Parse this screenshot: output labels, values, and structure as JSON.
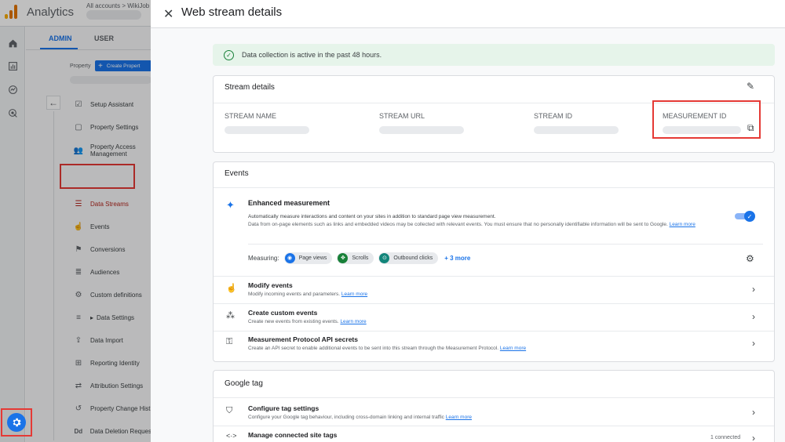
{
  "app": {
    "title": "Analytics",
    "breadcrumb": "All accounts > WikiJob",
    "logo_colors": [
      "#f9ab00",
      "#e37400",
      "#e37400"
    ]
  },
  "rail": {
    "icons": [
      "home-icon",
      "reports-icon",
      "explore-icon",
      "advertising-icon"
    ],
    "admin_gear": "settings-gear-icon"
  },
  "admin": {
    "tabs": [
      {
        "label": "ADMIN"
      },
      {
        "label": "USER"
      }
    ],
    "property_label": "Property",
    "create_property": "Create Propert",
    "menu": [
      {
        "label": "Setup Assistant",
        "icon": "☑"
      },
      {
        "label": "Property Settings",
        "icon": "▢"
      },
      {
        "label": "Property Access Management",
        "icon": "👥"
      },
      {
        "label": "Data Streams",
        "icon": "☰",
        "active": true
      },
      {
        "label": "Events",
        "icon": "☝"
      },
      {
        "label": "Conversions",
        "icon": "⚑"
      },
      {
        "label": "Audiences",
        "icon": "≣"
      },
      {
        "label": "Custom definitions",
        "icon": "⚙"
      },
      {
        "label": "Data Settings",
        "icon": "≡",
        "caret": "▸"
      },
      {
        "label": "Data Import",
        "icon": "⇪"
      },
      {
        "label": "Reporting Identity",
        "icon": "⊞"
      },
      {
        "label": "Attribution Settings",
        "icon": "⇄"
      },
      {
        "label": "Property Change Hist",
        "icon": "↺"
      },
      {
        "label": "Data Deletion Reques",
        "icon": "Dd"
      }
    ]
  },
  "drawer": {
    "title": "Web stream details",
    "banner": "Data collection is active in the past 48 hours.",
    "stream_details": {
      "title": "Stream details",
      "columns": [
        {
          "label": "STREAM NAME"
        },
        {
          "label": "STREAM URL"
        },
        {
          "label": "STREAM ID"
        },
        {
          "label": "MEASUREMENT ID"
        }
      ]
    },
    "events": {
      "title": "Events",
      "enhanced": {
        "title": "Enhanced measurement",
        "desc1": "Automatically measure interactions and content on your sites in addition to standard page view measurement.",
        "desc2": "Data from on-page elements such as links and embedded videos may be collected with relevant events. You must ensure that no personally identifiable information will be sent to Google.",
        "learn_more": "Learn more",
        "enabled": true
      },
      "measuring_label": "Measuring:",
      "chips": [
        {
          "label": "Page views",
          "color": "#1a73e8",
          "icon": "eye-icon"
        },
        {
          "label": "Scrolls",
          "color": "#188038",
          "icon": "scroll-icon"
        },
        {
          "label": "Outbound clicks",
          "color": "#12857a",
          "icon": "click-icon"
        }
      ],
      "more": "+ 3 more",
      "rows": [
        {
          "title": "Modify events",
          "desc": "Modify incoming events and parameters.",
          "link": "Learn more"
        },
        {
          "title": "Create custom events",
          "desc": "Create new events from existing events.",
          "link": "Learn more"
        },
        {
          "title": "Measurement Protocol API secrets",
          "desc": "Create an API secret to enable additional events to be sent into this stream through the Measurement Protocol.",
          "link": "Learn more"
        }
      ]
    },
    "google_tag": {
      "title": "Google tag",
      "rows": [
        {
          "title": "Configure tag settings",
          "desc": "Configure your Google tag behaviour, including cross-domain linking and internal traffic",
          "link": "Learn more"
        },
        {
          "title": "Manage connected site tags",
          "status": "1 connected"
        }
      ]
    }
  }
}
